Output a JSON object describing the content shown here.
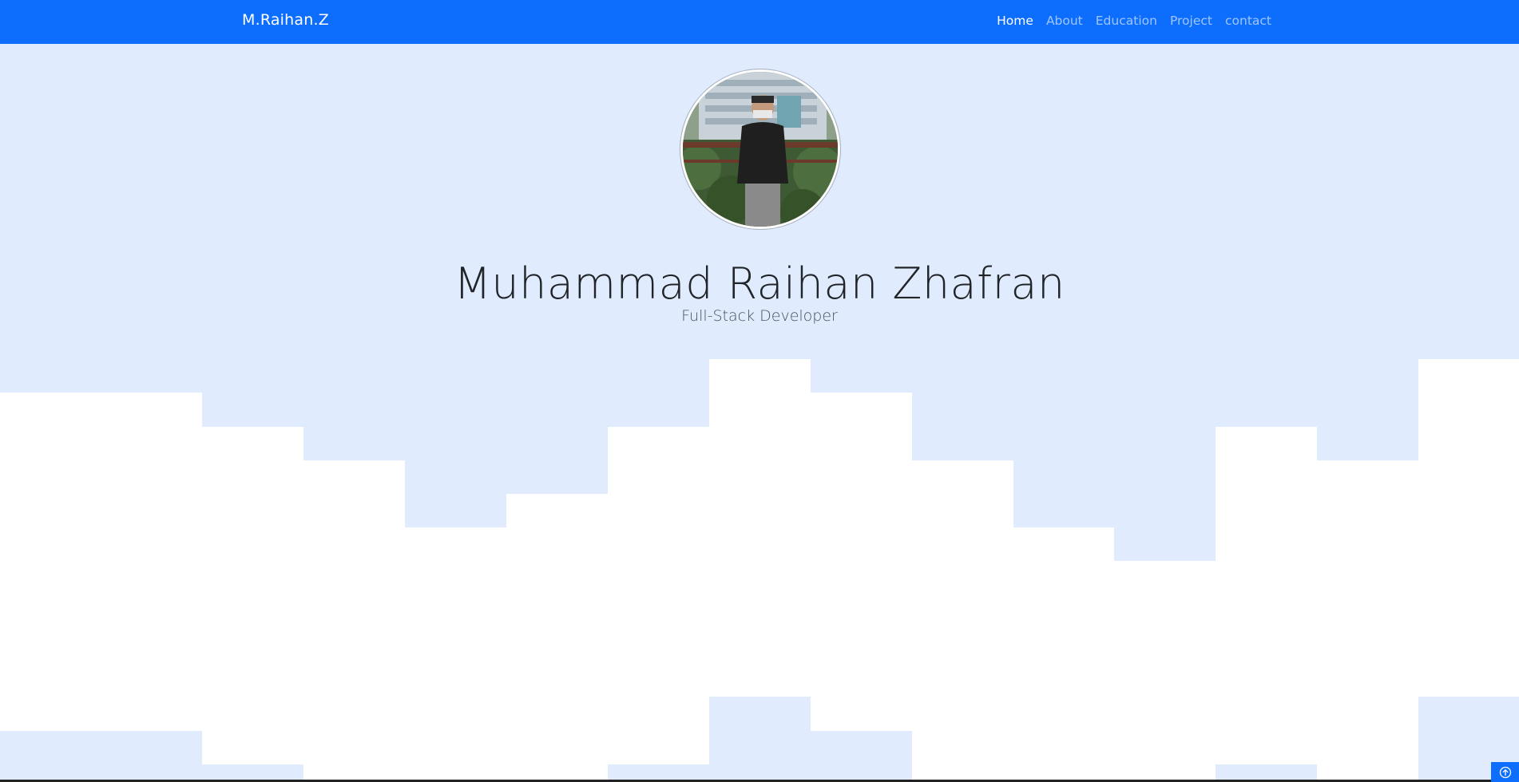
{
  "navbar": {
    "brand": "M.Raihan.Z",
    "links": [
      {
        "label": "Home",
        "active": true
      },
      {
        "label": "About",
        "active": false
      },
      {
        "label": "Education",
        "active": false
      },
      {
        "label": "Project",
        "active": false
      },
      {
        "label": "contact",
        "active": false
      }
    ]
  },
  "hero": {
    "title": "Muhammad Raihan Zhafran",
    "subtitle": "Full-Stack Developer",
    "avatar_icon": "profile-photo"
  },
  "colors": {
    "navbar": "#0d6efd",
    "hero_bg": "#e0ecfe",
    "page_bg": "#ffffff",
    "title_text": "#212529"
  },
  "back_to_top": {
    "icon": "arrow-up-circle-icon"
  }
}
